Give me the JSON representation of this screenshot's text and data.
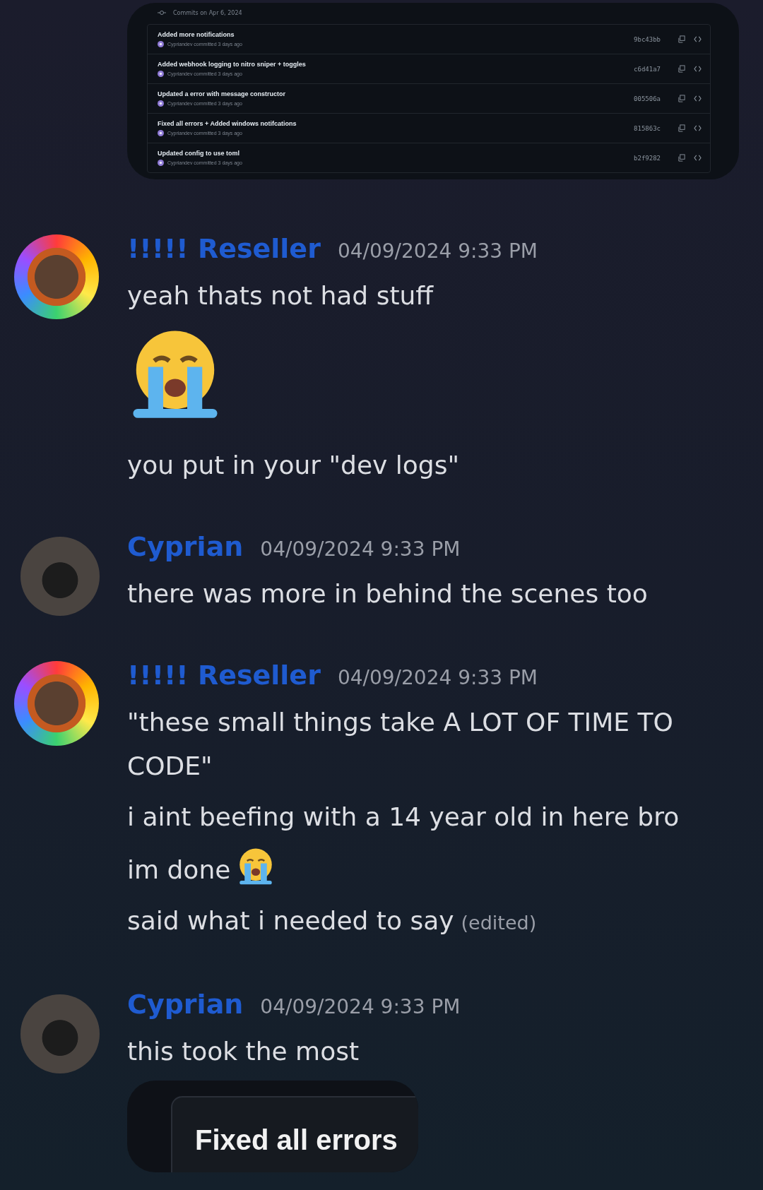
{
  "commit_image": {
    "header": "Commits on Apr 6, 2024",
    "commits": [
      {
        "title": "Added more notifications",
        "meta": "Cypriandev committed 3 days ago",
        "hash": "9bc43bb"
      },
      {
        "title": "Added webhook logging to nitro sniper + toggles",
        "meta": "Cypriandev committed 3 days ago",
        "hash": "c6d41a7"
      },
      {
        "title": "Updated a error with message constructor",
        "meta": "Cypriandev committed 3 days ago",
        "hash": "005506a"
      },
      {
        "title": "Fixed all errors + Added windows notifcations",
        "meta": "Cypriandev committed 3 days ago",
        "hash": "815863c"
      },
      {
        "title": "Updated config to use toml",
        "meta": "Cypriandev committed 3 days ago",
        "hash": "b2f9282"
      }
    ]
  },
  "messages": [
    {
      "author": "!!!!! Reseller",
      "kind": "framed",
      "timestamp": "04/09/2024 9:33 PM",
      "lines": [
        {
          "kind": "text",
          "text": "yeah thats not had stuff"
        },
        {
          "kind": "jumbo_emoji"
        },
        {
          "kind": "text",
          "text": "you put in your \"dev logs\""
        }
      ]
    },
    {
      "author": "Cyprian",
      "kind": "plain",
      "timestamp": "04/09/2024 9:33 PM",
      "lines": [
        {
          "kind": "text",
          "text": "there was more in behind the scenes too"
        }
      ]
    },
    {
      "author": "!!!!! Reseller",
      "kind": "framed",
      "timestamp": "04/09/2024 9:33 PM",
      "lines": [
        {
          "kind": "text",
          "text": "\"these small things take A LOT OF TIME TO CODE\""
        },
        {
          "kind": "text",
          "text": "i aint beefing with a 14 year old in here bro"
        },
        {
          "kind": "text",
          "text": "im done",
          "emoji": true
        },
        {
          "kind": "text",
          "text": "said what i needed to say",
          "edited": "(edited)"
        }
      ]
    },
    {
      "author": "Cyprian",
      "kind": "plain",
      "timestamp": "04/09/2024 9:33 PM",
      "lines": [
        {
          "kind": "text",
          "text": "this took the most"
        },
        {
          "kind": "image",
          "text": "Fixed all errors"
        }
      ]
    }
  ]
}
